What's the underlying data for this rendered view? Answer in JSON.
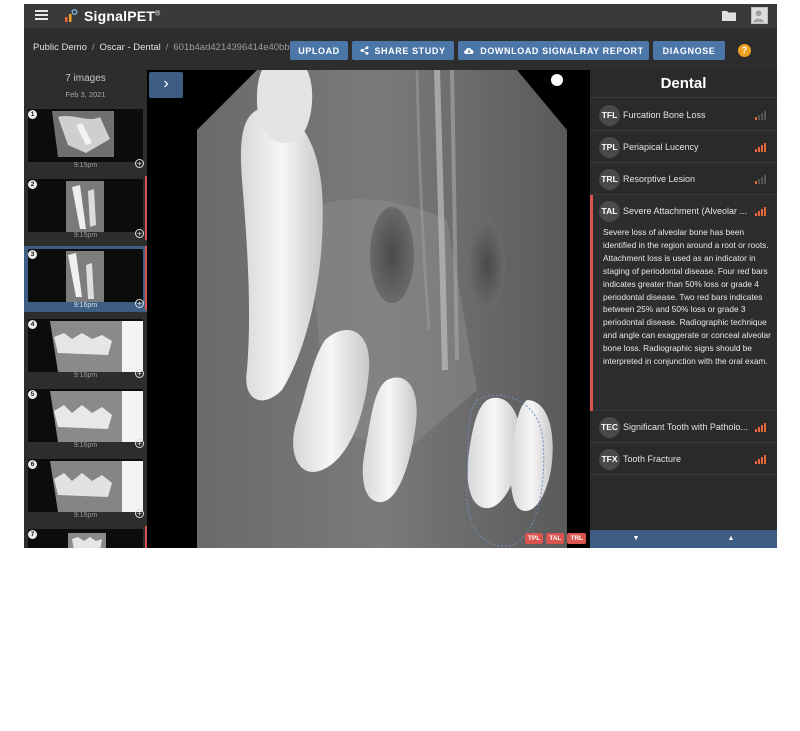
{
  "app": {
    "logo_text": "SignalPET",
    "logo_mark": "®"
  },
  "breadcrumb": {
    "items": [
      "Public Demo",
      "Oscar - Dental"
    ],
    "study_id": "601b4ad4214396414e40bb9"
  },
  "toolbar": {
    "upload": "UPLOAD",
    "share": "SHARE STUDY",
    "download": "DOWNLOAD SIGNALRAY REPORT",
    "diagnose": "DIAGNOSE",
    "help": "?"
  },
  "thumbnails": {
    "count_label": "7 images",
    "date": "Feb 3, 2021",
    "items": [
      {
        "number": "1",
        "time": "9:15pm",
        "flagged": false,
        "selected": false
      },
      {
        "number": "2",
        "time": "9:15pm",
        "flagged": true,
        "selected": false
      },
      {
        "number": "3",
        "time": "9:16pm",
        "flagged": true,
        "selected": true
      },
      {
        "number": "4",
        "time": "9:16pm",
        "flagged": false,
        "selected": false
      },
      {
        "number": "5",
        "time": "9:16pm",
        "flagged": false,
        "selected": false
      },
      {
        "number": "6",
        "time": "9:16pm",
        "flagged": false,
        "selected": false
      },
      {
        "number": "7",
        "time": "",
        "flagged": true,
        "selected": false
      }
    ]
  },
  "viewer": {
    "expand_symbol": "›",
    "tags": [
      "TPL",
      "TAL",
      "TRL"
    ]
  },
  "findings": {
    "title": "Dental",
    "items": [
      {
        "code": "TFL",
        "name": "Furcation Bone Loss",
        "severity_bars": 1
      },
      {
        "code": "TPL",
        "name": "Periapical Lucency",
        "severity_bars": 4
      },
      {
        "code": "TRL",
        "name": "Resorptive Lesion",
        "severity_bars": 1
      },
      {
        "code": "TAL",
        "name": "Severe Attachment (Alveolar ...",
        "severity_bars": 4,
        "expanded": true,
        "description": "Severe loss of alveolar bone has been identified in the region around a root or roots. Attachment loss is used as an indicator in staging of periodontal disease. Four red bars indicates greater than 50% loss or grade 4 periodontal disease. Two red bars indicates between 25% and 50% loss or grade 3 periodontal disease. Radiographic technique and angle can exaggerate or conceal alveolar bone loss. Radiographic signs should be interpreted in conjunction with the oral exam."
      },
      {
        "code": "TEC",
        "name": "Significant Tooth with Patholo...",
        "severity_bars": 4
      },
      {
        "code": "TFX",
        "name": "Tooth Fracture",
        "severity_bars": 4
      }
    ],
    "footer": {
      "down": "▼",
      "up": "▲"
    }
  },
  "colors": {
    "accent": "#4a76a8",
    "alert": "#d9534f",
    "severity": "#e8663a",
    "help": "#f0a020"
  }
}
